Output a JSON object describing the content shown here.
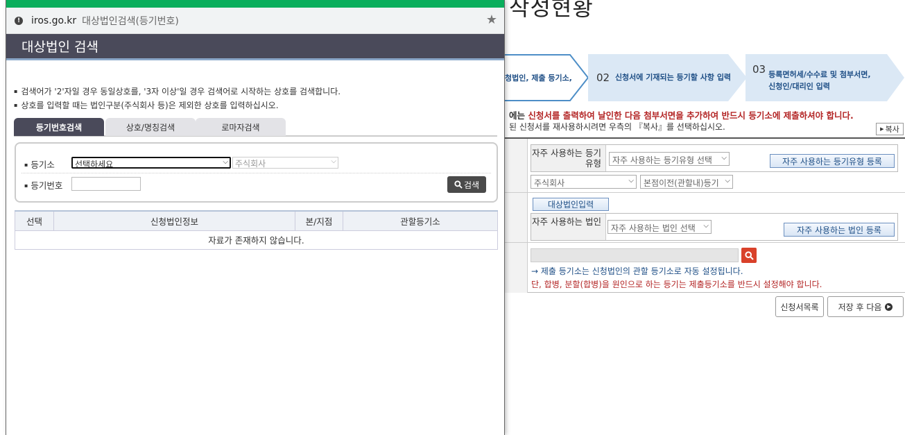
{
  "background": {
    "page_title": "작성현황",
    "steps": [
      {
        "num": "",
        "label": "청법인, 제출 등기소,"
      },
      {
        "num": "02",
        "label": "신청서에 기재되는 등기할 사항 입력"
      },
      {
        "num": "03",
        "label_line1": "등록면허세/수수료 및 첨부서면,",
        "label_line2": "신청인/대리인 입력"
      }
    ],
    "warning_prefix": "에는 ",
    "warning_red": "신청서를 출력하여 날인한 다음 첨부서면을 추가하여 반드시 등기소에 제출하셔야 합니다.",
    "warning2": "된 신청서를 재사용하시려면 우측의 『복사』를 선택하십시오.",
    "copy_button": "복사",
    "freq_type_label": "자주 사용하는 등기유형",
    "freq_type_placeholder": "자주 사용하는 등기유형 선택",
    "freq_type_register": "자주 사용하는 등기유형 등록",
    "company_type": "주식회사",
    "reg_type": "본점이전(관할내)등기",
    "target_corp_button": "대상법인입력",
    "freq_corp_label": "자주 사용하는 법인",
    "freq_corp_placeholder": "자주 사용하는 법인 선택",
    "freq_corp_register": "자주 사용하는 법인 등록",
    "note_blue": "→ 제출 등기소는 신청법인의 관할 등기소로 자동 설정됩니다.",
    "note_red": "단, 합병, 분할(합병)을 원인으로 하는 등기는 제출등기소를 반드시 설정해야 합니다.",
    "list_button": "신청서목록",
    "save_next_button": "저장 후 다음"
  },
  "popup": {
    "host": "iros.go.kr",
    "window_title": "대상법인검색(등기번호)",
    "header": "대상법인 검색",
    "guides": [
      "검색어가 '2'자일 경우 동일상호를, '3자 이상'일 경우 검색어로 시작하는 상호를 검색합니다.",
      "상호를 입력할 때는 법인구분(주식회사 등)은 제외한 상호를 입력하십시오."
    ],
    "tabs": [
      "등기번호검색",
      "상호/명칭검색",
      "로마자검색"
    ],
    "form": {
      "office_label": "등기소",
      "office_value": "선택하세요",
      "corp_type_value": "주식회사",
      "regno_label": "등기번호",
      "regno_value": "",
      "search_button": "검색"
    },
    "table": {
      "headers": [
        "선택",
        "신청법인정보",
        "본/지점",
        "관할등기소"
      ],
      "empty_message": "자료가 존재하지 않습니다."
    }
  },
  "colors": {
    "popup_header": "#4a4a5a",
    "browser_accent": "#0aae5c",
    "warning_red": "#b32525",
    "link_blue": "#1f4f86"
  }
}
